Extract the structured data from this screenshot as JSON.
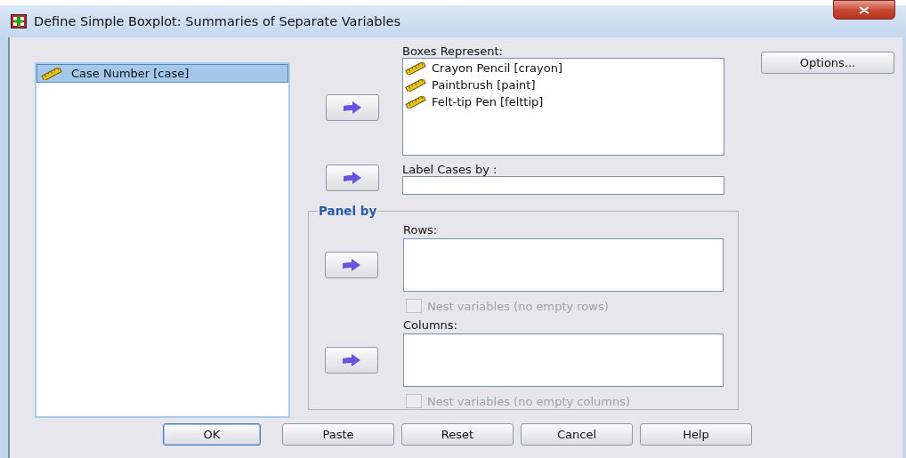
{
  "window": {
    "title": "Define Simple Boxplot: Summaries of Separate Variables"
  },
  "source_list": {
    "items": [
      {
        "label": "Case Number [case]",
        "selected": true
      }
    ]
  },
  "boxes_represent": {
    "label": "Boxes Represent:",
    "items": [
      {
        "label": "Crayon Pencil [crayon]",
        "selected": false
      },
      {
        "label": "Paintbrush [paint]",
        "selected": false
      },
      {
        "label": "Felt-tip Pen [felttip]",
        "selected": false
      }
    ]
  },
  "label_cases_by": {
    "label": "Label Cases by :"
  },
  "panel_by": {
    "title": "Panel by",
    "sections": [
      {
        "label": "Rows:",
        "nest": {
          "label": "Nest variables (no empty rows)",
          "checked": false,
          "disabled": true
        }
      },
      {
        "label": "Columns:",
        "nest": {
          "label": "Nest variables (no empty columns)",
          "checked": false,
          "disabled": true
        }
      }
    ]
  },
  "options_button": {
    "label": "Options..."
  },
  "buttons": [
    {
      "label": "OK",
      "default": true
    },
    {
      "label": "Paste",
      "default": false
    },
    {
      "label": "Reset",
      "default": false
    },
    {
      "label": "Cancel",
      "default": false
    },
    {
      "label": "Help",
      "default": false
    }
  ]
}
